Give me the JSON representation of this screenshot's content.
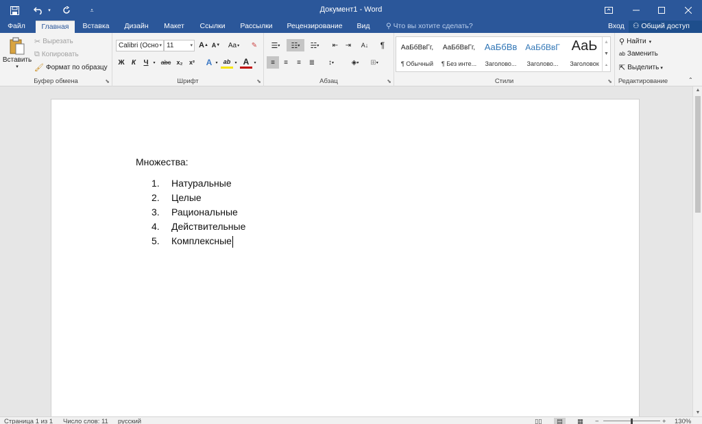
{
  "window": {
    "title": "Документ1 - Word",
    "icons": [
      "save-icon",
      "undo-icon",
      "undo-dropdown-icon",
      "repeat-icon",
      "customize-qat-icon",
      "ribbon-display-options-icon",
      "minimize-icon",
      "maximize-icon",
      "close-icon"
    ]
  },
  "tabs": [
    {
      "label": "Файл"
    },
    {
      "label": "Главная"
    },
    {
      "label": "Вставка"
    },
    {
      "label": "Дизайн"
    },
    {
      "label": "Макет"
    },
    {
      "label": "Ссылки"
    },
    {
      "label": "Рассылки"
    },
    {
      "label": "Рецензирование"
    },
    {
      "label": "Вид"
    }
  ],
  "active_tab": "Главная",
  "tell_me": "Что вы хотите сделать?",
  "sign_in": "Вход",
  "share": "Общий доступ",
  "ribbon": {
    "clipboard": {
      "label": "Буфер обмена",
      "paste": "Вставить",
      "cut": "Вырезать",
      "copy": "Копировать",
      "format_painter": "Формат по образцу"
    },
    "font": {
      "label": "Шрифт",
      "font_name": "Calibri (Осно",
      "font_size": "11",
      "bold": "Ж",
      "italic": "К",
      "underline": "Ч",
      "strikethrough": "abc",
      "subscript": "x₂",
      "superscript": "x²",
      "grow": "A",
      "shrink": "A",
      "change_case": "Aa",
      "font_color": "A",
      "text_effects": "A",
      "highlight": "ab"
    },
    "paragraph": {
      "label": "Абзац",
      "pilcrow": "¶"
    },
    "styles": {
      "label": "Стили",
      "items": [
        {
          "preview": "АаБбВвГг,",
          "name": "¶ Обычный"
        },
        {
          "preview": "АаБбВвГг,",
          "name": "¶ Без инте..."
        },
        {
          "preview": "АаБбВв",
          "name": "Заголово..."
        },
        {
          "preview": "АаБбВвГ",
          "name": "Заголово..."
        },
        {
          "preview": "АаЬ",
          "name": "Заголовок"
        }
      ]
    },
    "editing": {
      "label": "Редактирование",
      "find": "Найти",
      "replace": "Заменить",
      "select": "Выделить"
    }
  },
  "document": {
    "heading": "Множества:",
    "list": [
      {
        "num": "1.",
        "text": "Натуральные"
      },
      {
        "num": "2.",
        "text": "Целые"
      },
      {
        "num": "3.",
        "text": "Рациональные"
      },
      {
        "num": "4.",
        "text": "Действительные"
      },
      {
        "num": "5.",
        "text": "Комплексные"
      }
    ]
  },
  "status": {
    "page": "Страница 1 из 1",
    "words": "Число слов: 11",
    "language": "русский",
    "zoom_minus": "−",
    "zoom_plus": "+",
    "zoom": "130%"
  },
  "colors": {
    "accent": "#2b579a",
    "ribbon_bg": "#f3f3f3",
    "canvas_bg": "#e6e6e6"
  }
}
